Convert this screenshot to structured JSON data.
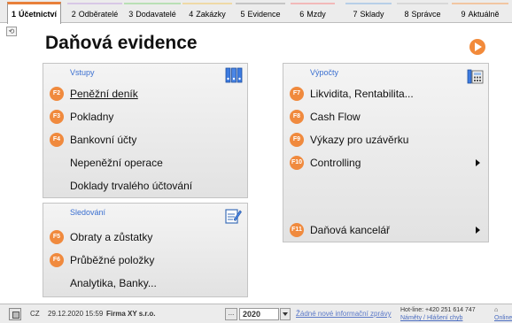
{
  "tabs": [
    {
      "num": "1",
      "label": "Účetnictví",
      "active": true
    },
    {
      "num": "2",
      "label": "Odběratelé",
      "active": false
    },
    {
      "num": "3",
      "label": "Dodavatelé",
      "active": false
    },
    {
      "num": "4",
      "label": "Zakázky",
      "active": false
    },
    {
      "num": "5",
      "label": "Evidence",
      "active": false
    },
    {
      "num": "6",
      "label": "Mzdy",
      "active": false
    },
    {
      "num": "7",
      "label": "Sklady",
      "active": false
    },
    {
      "num": "8",
      "label": "Správce",
      "active": false
    },
    {
      "num": "9",
      "label": "Aktuálně",
      "active": false
    }
  ],
  "page": {
    "title": "Daňová evidence"
  },
  "panels": {
    "vstupy": {
      "title": "Vstupy",
      "items": [
        {
          "key": "F2",
          "label": "Peněžní deník"
        },
        {
          "key": "F3",
          "label": "Pokladny"
        },
        {
          "key": "F4",
          "label": "Bankovní účty"
        },
        {
          "key": "",
          "label": "Nepeněžní operace"
        },
        {
          "key": "",
          "label": "Doklady trvalého účtování"
        }
      ]
    },
    "sledovani": {
      "title": "Sledování",
      "items": [
        {
          "key": "F5",
          "label": "Obraty a zůstatky"
        },
        {
          "key": "F6",
          "label": "Průběžné položky"
        },
        {
          "key": "",
          "label": "Analytika, Banky..."
        }
      ]
    },
    "vypocty": {
      "title": "Výpočty",
      "items": [
        {
          "key": "F7",
          "label": "Likvidita, Rentabilita..."
        },
        {
          "key": "F8",
          "label": "Cash Flow"
        },
        {
          "key": "F9",
          "label": "Výkazy pro uzávěrku"
        },
        {
          "key": "F10",
          "label": "Controlling"
        },
        {
          "key": "F11",
          "label": "Daňová kancelář"
        }
      ]
    }
  },
  "statusbar": {
    "country": "CZ",
    "datetime": "29.12.2020 15:59",
    "company": "Firma XY s.r.o.",
    "year_button": "...",
    "year": "2020",
    "message": "Žádné nové informační zprávy",
    "hotline": "Hot-line: +420 251 614 747",
    "ideas": "Náměty / Hlášení chyb",
    "online": "Online"
  },
  "colors": {
    "accent": "#f08a3e",
    "panel_title": "#3a6fd0"
  }
}
